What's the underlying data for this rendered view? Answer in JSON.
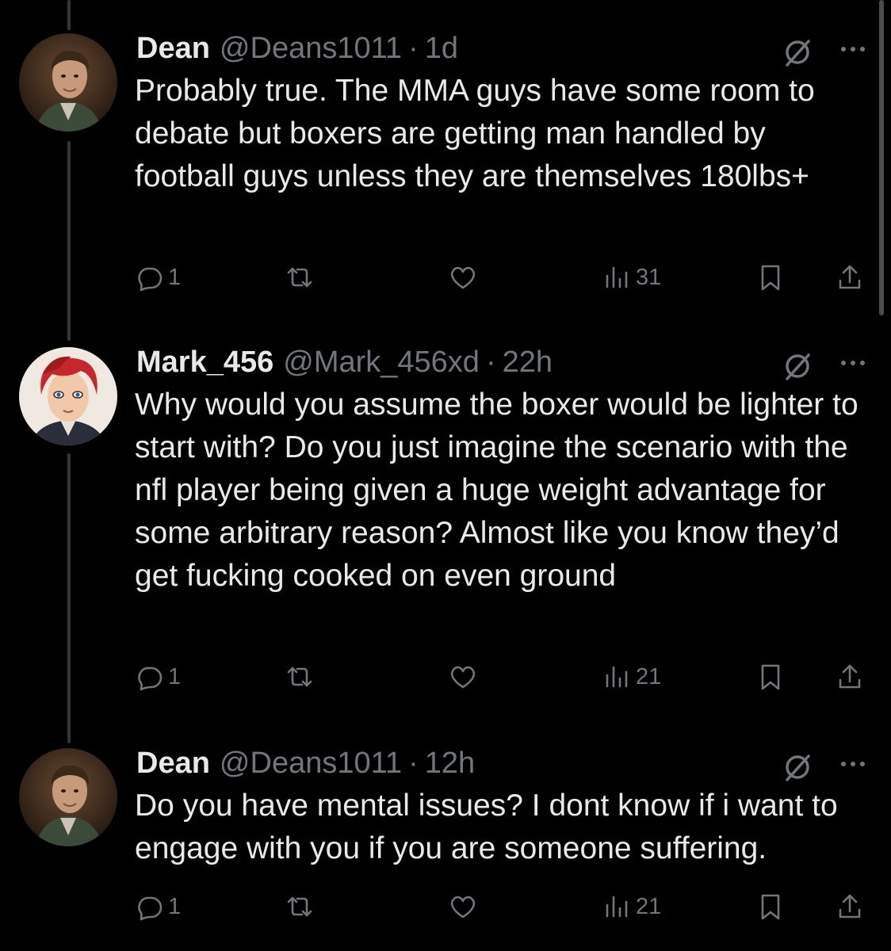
{
  "tweets": [
    {
      "name": "Dean",
      "handle": "@Deans1011",
      "separator": "·",
      "time": "1d",
      "text": "Probably true. The MMA guys have some room to debate but boxers are getting man handled by football guys unless they are themselves 180lbs+",
      "replies": "1",
      "views": "31"
    },
    {
      "name": "Mark_456",
      "handle": "@Mark_456xd",
      "separator": "·",
      "time": "22h",
      "text": "Why would you assume the boxer would be lighter to start with? Do you just imagine the scenario with the nfl player being given a huge weight advantage for some arbitrary reason? Almost like you know they’d get fucking cooked on even ground",
      "replies": "1",
      "views": "21"
    },
    {
      "name": "Dean",
      "handle": "@Deans1011",
      "separator": "·",
      "time": "12h",
      "text": "Do you have mental issues? I dont know if i want to engage with you if you are someone suffering.",
      "replies": "1",
      "views": "21"
    }
  ],
  "icons": {
    "reply": "reply-icon",
    "retweet": "retweet-icon",
    "like": "like-icon",
    "views": "views-icon",
    "bookmark": "bookmark-icon",
    "share": "share-icon",
    "grok": "grok-icon",
    "more": "more-icon"
  },
  "colors": {
    "background": "#000000",
    "text": "#e7e9ea",
    "muted": "#71767b",
    "thread_line": "#333639"
  }
}
